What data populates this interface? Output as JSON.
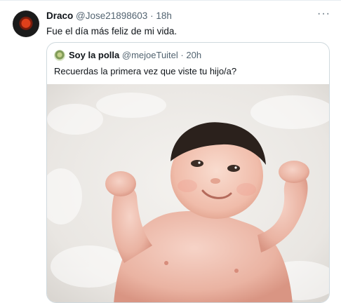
{
  "tweet": {
    "display_name": "Draco",
    "handle": "@Jose21898603",
    "separator": "·",
    "time": "18h",
    "more_icon": "more-horizontal-icon",
    "text": "Fue el día más feliz de mi vida."
  },
  "quoted_tweet": {
    "display_name": "Soy la polla",
    "handle": "@mejoeTuitel",
    "separator": "·",
    "time": "20h",
    "text": "Recuerdas la primera vez que viste tu hijo/a?",
    "media_alt": "baby smiling on a white fluffy blanket"
  }
}
